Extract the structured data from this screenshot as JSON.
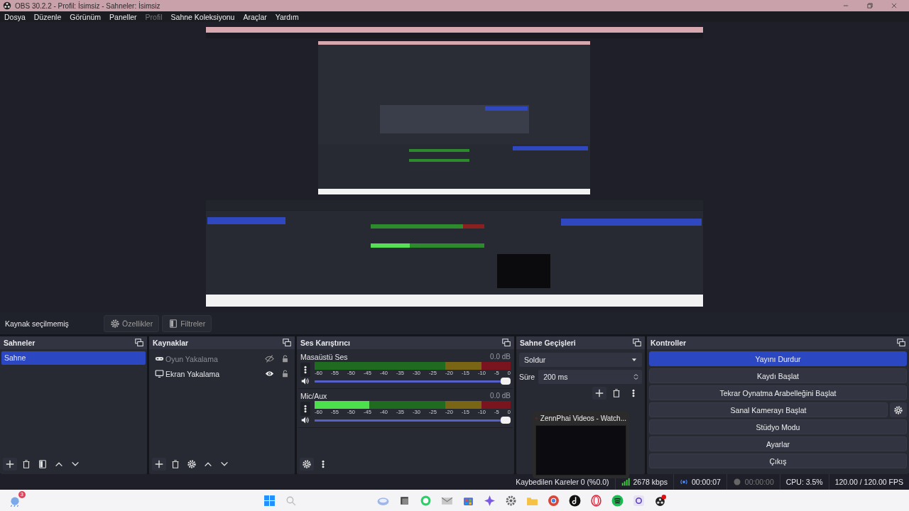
{
  "window": {
    "title": "OBS 30.2.2 - Profil: İsimsiz - Sahneler: İsimsiz"
  },
  "menu": [
    {
      "label": "Dosya",
      "disabled": false
    },
    {
      "label": "Düzenle",
      "disabled": false
    },
    {
      "label": "Görünüm",
      "disabled": false
    },
    {
      "label": "Paneller",
      "disabled": false
    },
    {
      "label": "Profil",
      "disabled": true
    },
    {
      "label": "Sahne Koleksiyonu",
      "disabled": false
    },
    {
      "label": "Araçlar",
      "disabled": false
    },
    {
      "label": "Yardım",
      "disabled": false
    }
  ],
  "source_bar": {
    "label": "Kaynak seçilmemiş",
    "buttons": [
      {
        "label": "Özellikler",
        "kind": "properties",
        "disabled": true
      },
      {
        "label": "Filtreler",
        "kind": "filters",
        "disabled": true
      }
    ]
  },
  "scenes": {
    "title": "Sahneler",
    "items": [
      {
        "label": "Sahne",
        "selected": true
      }
    ]
  },
  "sources": {
    "title": "Kaynaklar",
    "items": [
      {
        "label": "Oyun Yakalama",
        "kind": "game",
        "visible": false
      },
      {
        "label": "Ekran Yakalama",
        "kind": "display",
        "visible": true
      }
    ]
  },
  "mixer": {
    "title": "Ses Karıştırıcı",
    "channels": [
      {
        "name": "Masaüstü Ses",
        "reading": "0.0 dB",
        "meter": {
          "level": 0
        },
        "fader": {
          "level": 1
        },
        "ticks": [
          "-60",
          "-55",
          "-50",
          "-45",
          "-40",
          "-35",
          "-30",
          "-25",
          "-20",
          "-15",
          "-10",
          "-5",
          "0"
        ]
      },
      {
        "name": "Mic/Aux",
        "reading": "0.0 dB",
        "meter": {
          "level": 0.28
        },
        "fader": {
          "level": 1
        },
        "ticks": [
          "-60",
          "-55",
          "-50",
          "-45",
          "-40",
          "-35",
          "-30",
          "-25",
          "-20",
          "-15",
          "-10",
          "-5",
          "0"
        ]
      }
    ]
  },
  "transitions": {
    "title": "Sahne Geçişleri",
    "transition": "Soldur",
    "duration_label": "Süre",
    "duration": "200 ms"
  },
  "controls": {
    "title": "Kontroller",
    "buttons": [
      {
        "label": "Yayını Durdur",
        "active": true,
        "has_settings": false
      },
      {
        "label": "Kaydı Başlat",
        "active": false,
        "has_settings": false
      },
      {
        "label": "Tekrar Oynatma Arabelleğini Başlat",
        "active": false,
        "has_settings": false
      },
      {
        "label": "Sanal Kamerayı Başlat",
        "active": false,
        "has_settings": true
      },
      {
        "label": "Stüdyo Modu",
        "active": false,
        "has_settings": false
      },
      {
        "label": "Ayarlar",
        "active": false,
        "has_settings": false
      },
      {
        "label": "Çıkış",
        "active": false,
        "has_settings": false
      }
    ]
  },
  "status": {
    "dropped": "Kaybedilen Kareler 0 (%0.0)",
    "bitrate": "2678 kbps",
    "stream_time": "00:00:07",
    "streaming": true,
    "record_time": "00:00:00",
    "recording": false,
    "cpu": "CPU: 3.5%",
    "fps": "120.00 / 120.00 FPS"
  },
  "thumbnail": {
    "title": "ZennPhai Videos - Watch..."
  },
  "taskbar": {
    "weather_badge": "3"
  }
}
